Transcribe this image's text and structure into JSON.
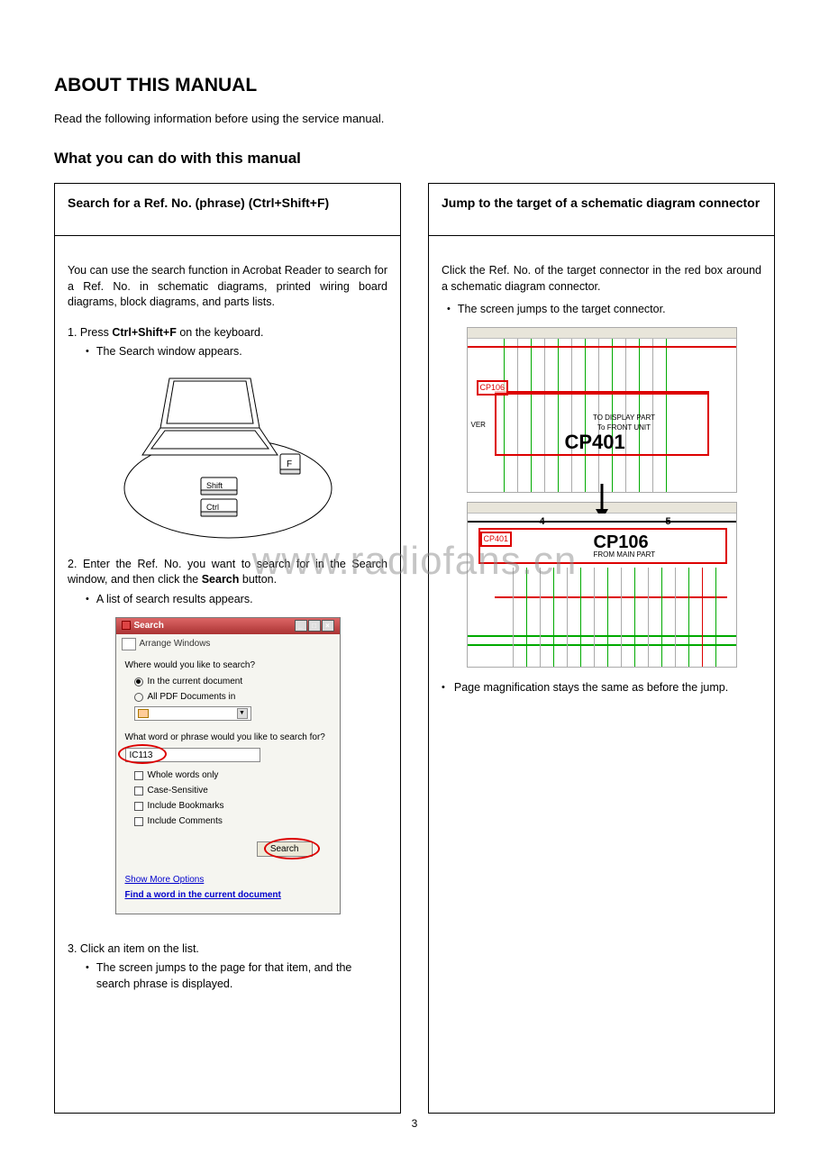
{
  "page_number": "3",
  "watermark": "www.radiofans.cn",
  "h1": "ABOUT THIS MANUAL",
  "intro": "Read the following information before using the service manual.",
  "h2": "What you can do with this manual",
  "left": {
    "title": "Search for a Ref. No. (phrase) (Ctrl+Shift+F)",
    "p1": "You can use the search function in Acrobat Reader to search for a Ref. No. in schematic diagrams, printed wiring board diagrams, block diagrams, and parts lists.",
    "step1_prefix": "1. Press ",
    "step1_keys": "Ctrl+Shift+F",
    "step1_suffix": " on the keyboard.",
    "step1_bullet": "The Search window appears.",
    "laptop_keys": {
      "f": "F",
      "shift": "Shift",
      "ctrl": "Ctrl"
    },
    "step2_prefix": "2. Enter the Ref. No. you want to search for in the Search window, and then click the ",
    "step2_bold": "Search",
    "step2_suffix": " button.",
    "step2_bullet": "A list of search results appears.",
    "search_window": {
      "title": "Search",
      "toolbar": "Arrange Windows",
      "where_label": "Where would you like to search?",
      "opt_current": "In the current document",
      "opt_allpdf": "All PDF Documents in",
      "what_label": "What word or phrase would you like to search for?",
      "input_value": "IC113",
      "chk_whole": "Whole words only",
      "chk_case": "Case-Sensitive",
      "chk_book": "Include Bookmarks",
      "chk_comm": "Include Comments",
      "btn": "Search",
      "link_more": "Show More Options",
      "link_find": "Find a word in the current document"
    },
    "step3_line": "3. Click an item on the list.",
    "step3_bullet": "The screen jumps to the page for that item, and the search phrase is displayed."
  },
  "right": {
    "title": "Jump to the target of a schematic diagram connector",
    "p1": "Click the Ref. No. of the target connector in the red box around a schematic diagram connector.",
    "bullet1": "The screen jumps to the target connector.",
    "sch_top": {
      "ref1": "CP106",
      "ver": "VER",
      "to1": "TO DISPLAY PART",
      "to2": "To FRONT UNIT",
      "big": "CP401"
    },
    "sch_bot": {
      "ref1": "CP401",
      "num4": "4",
      "num5": "5",
      "big": "CP106",
      "sub": "FROM MAIN PART"
    },
    "bullet2": "Page magnification stays the same as before the jump."
  }
}
